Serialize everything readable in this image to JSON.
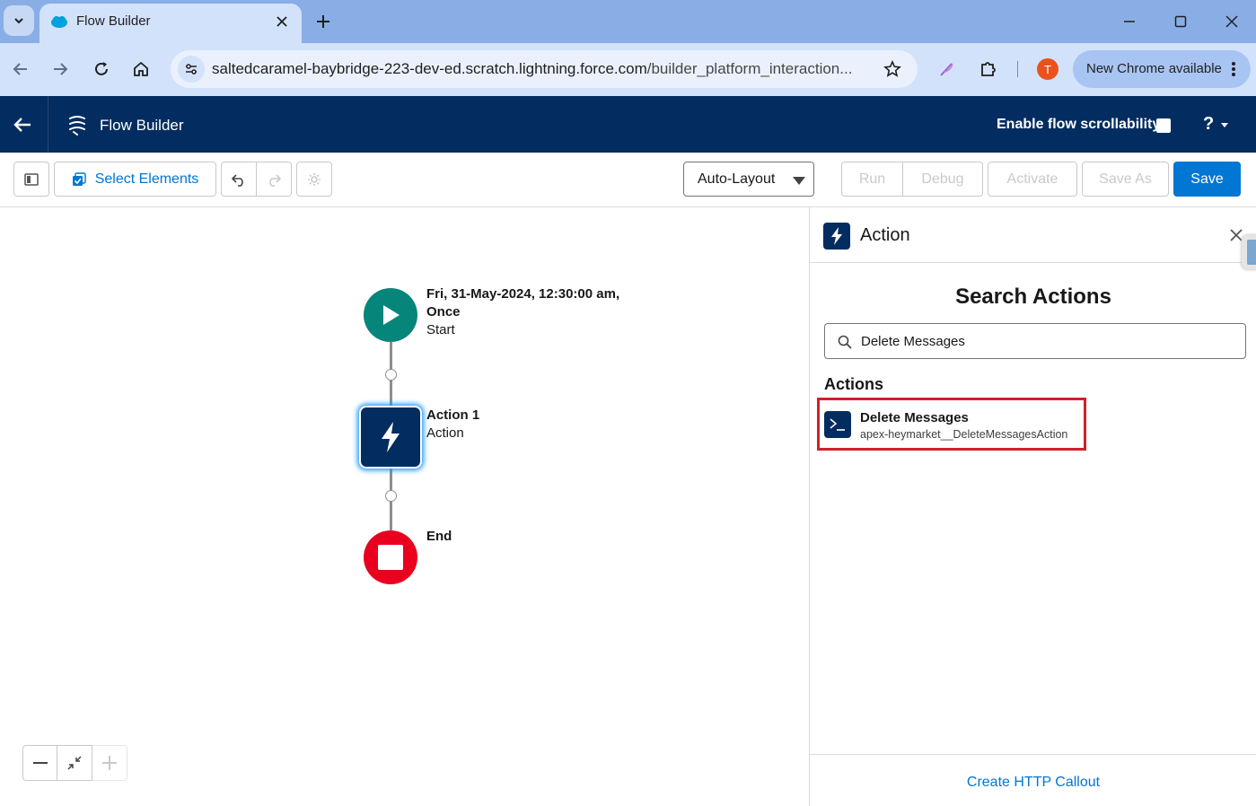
{
  "browser": {
    "tab_title": "Flow Builder",
    "url_host": "saltedcaramel-baybridge-223-dev-ed.scratch.lightning.force.com",
    "url_path": "/builder_platform_interaction...",
    "profile_initial": "T",
    "update_label": "New Chrome available"
  },
  "header": {
    "app_title": "Flow Builder",
    "scroll_label": "Enable flow scrollability",
    "help_label": "?"
  },
  "toolbar": {
    "select_elements_label": "Select Elements",
    "layout_value": "Auto-Layout",
    "run_label": "Run",
    "debug_label": "Debug",
    "activate_label": "Activate",
    "save_as_label": "Save As",
    "save_label": "Save"
  },
  "canvas": {
    "start": {
      "title_line1": "Fri, 31-May-2024, 12:30:00 am,",
      "title_line2": "Once",
      "subtitle": "Start"
    },
    "action": {
      "title": "Action 1",
      "subtitle": "Action"
    },
    "end": {
      "title": "End"
    }
  },
  "panel": {
    "title": "Action",
    "search_heading": "Search Actions",
    "search_value": "Delete Messages",
    "actions_heading": "Actions",
    "results": [
      {
        "title": "Delete Messages",
        "subtitle": "apex-heymarket__DeleteMessagesAction"
      }
    ],
    "footer_link": "Create HTTP Callout"
  },
  "colors": {
    "header_bg": "#032d60",
    "brand": "#0176d3",
    "start_node": "#06857a",
    "end_node": "#ea001e",
    "highlight_border": "#d0202b"
  }
}
